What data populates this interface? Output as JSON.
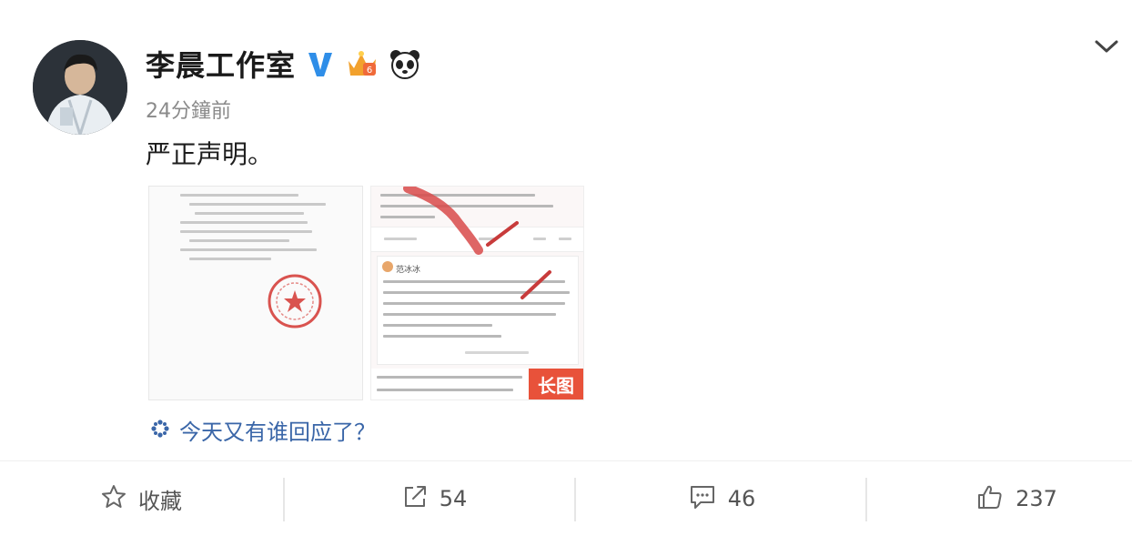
{
  "post": {
    "author": "李晨工作室",
    "time": "24分鐘前",
    "text": "严正声明。",
    "image_tag": "长图",
    "inner_card_name": "范冰冰",
    "topic": "今天又有谁回应了？"
  },
  "actions": {
    "favorite": "收藏",
    "repost": "54",
    "comment": "46",
    "like": "237"
  },
  "colors": {
    "verified": "#2f8ee8",
    "topic": "#3a66a8",
    "tag": "#e8523a",
    "stamp": "#d9534f"
  },
  "icons": [
    "verified-icon",
    "crown-badge-icon",
    "panda-icon",
    "chevron-down-icon",
    "topic-icon",
    "star-icon",
    "share-icon",
    "comment-icon",
    "like-icon"
  ]
}
